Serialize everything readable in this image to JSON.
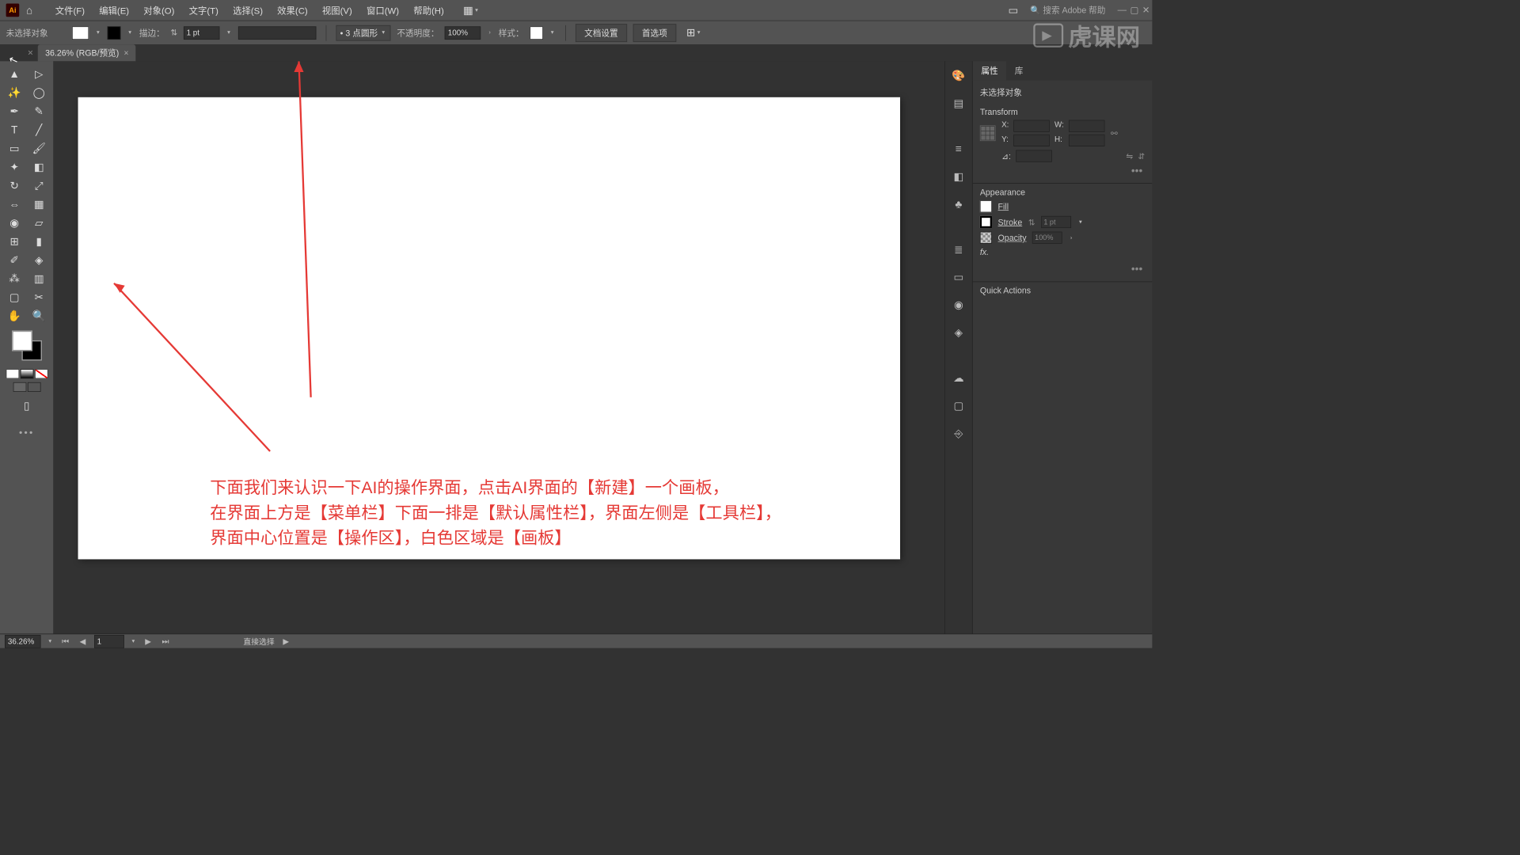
{
  "menu": {
    "file": "文件(F)",
    "edit": "编辑(E)",
    "object": "对象(O)",
    "type": "文字(T)",
    "select": "选择(S)",
    "effect": "效果(C)",
    "view": "视图(V)",
    "window": "窗口(W)",
    "help": "帮助(H)"
  },
  "search_placeholder": "搜索 Adobe 帮助",
  "control": {
    "no_selection": "未选择对象",
    "stroke_label": "描边：",
    "stroke_pt": "1 pt",
    "brush": "3 点圆形",
    "opacity_label": "不透明度：",
    "opacity_val": "100%",
    "style_label": "样式：",
    "doc_setup": "文档设置",
    "prefs": "首选项"
  },
  "tab": {
    "title": "36.26% (RGB/预览)"
  },
  "status": {
    "zoom": "36.26%",
    "artboard": "1",
    "tool": "直接选择"
  },
  "panels": {
    "tab_props": "属性",
    "tab_lib": "库",
    "no_sel": "未选择对象",
    "transform": "Transform",
    "x": "X:",
    "y": "Y:",
    "w": "W:",
    "h": "H:",
    "angle": "⊿:",
    "appearance": "Appearance",
    "fill": "Fill",
    "stroke": "Stroke",
    "stroke_val": "1 pt",
    "opacity": "Opacity",
    "opacity_val": "100%",
    "fx": "fx.",
    "quick": "Quick Actions"
  },
  "annotation": {
    "line1": "下面我们来认识一下AI的操作界面，点击AI界面的【新建】一个画板，",
    "line2": "在界面上方是【菜单栏】下面一排是【默认属性栏】，界面左侧是【工具栏】，",
    "line3": "界面中心位置是【操作区】，白色区域是【画板】"
  },
  "watermark": "虎课网"
}
